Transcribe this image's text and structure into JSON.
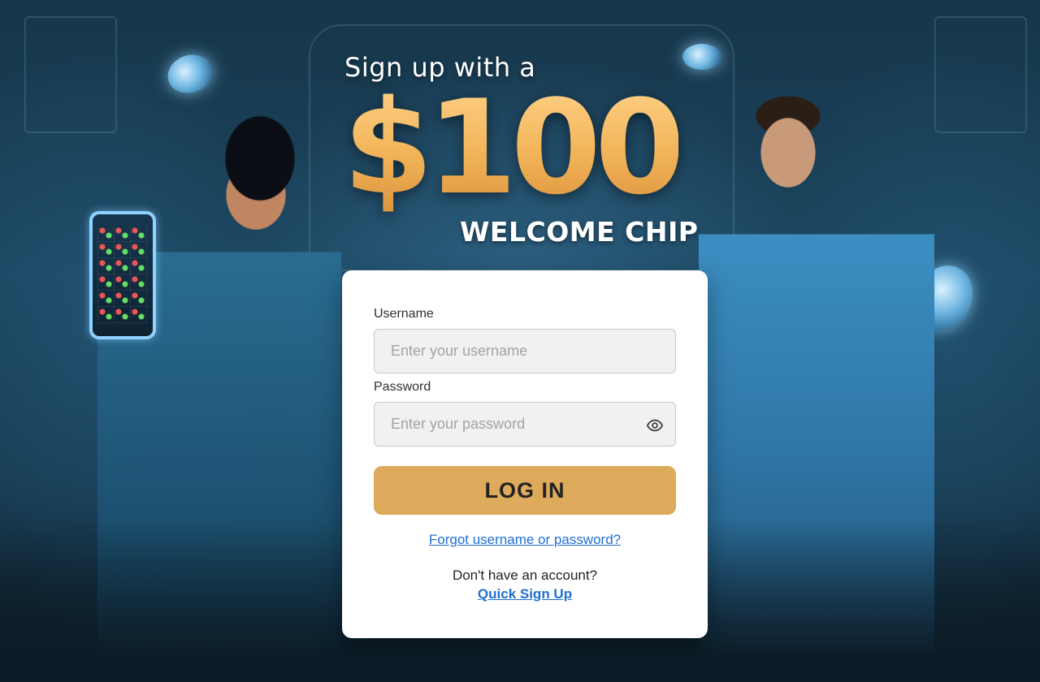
{
  "promo": {
    "headline": "Sign up with a",
    "amount": "$100",
    "subline": "WELCOME CHIP"
  },
  "login": {
    "username_label": "Username",
    "username_placeholder": "Enter your username",
    "password_label": "Password",
    "password_placeholder": "Enter your password",
    "login_button": "LOG IN",
    "forgot_link": "Forgot username or password?",
    "no_account_text": "Don't have an account?",
    "signup_link": "Quick Sign Up"
  },
  "colors": {
    "accent_gold": "#deab5c",
    "link_blue": "#1f6fd1",
    "background": "#16364a"
  },
  "icons": {
    "password_toggle": "eye-icon"
  }
}
